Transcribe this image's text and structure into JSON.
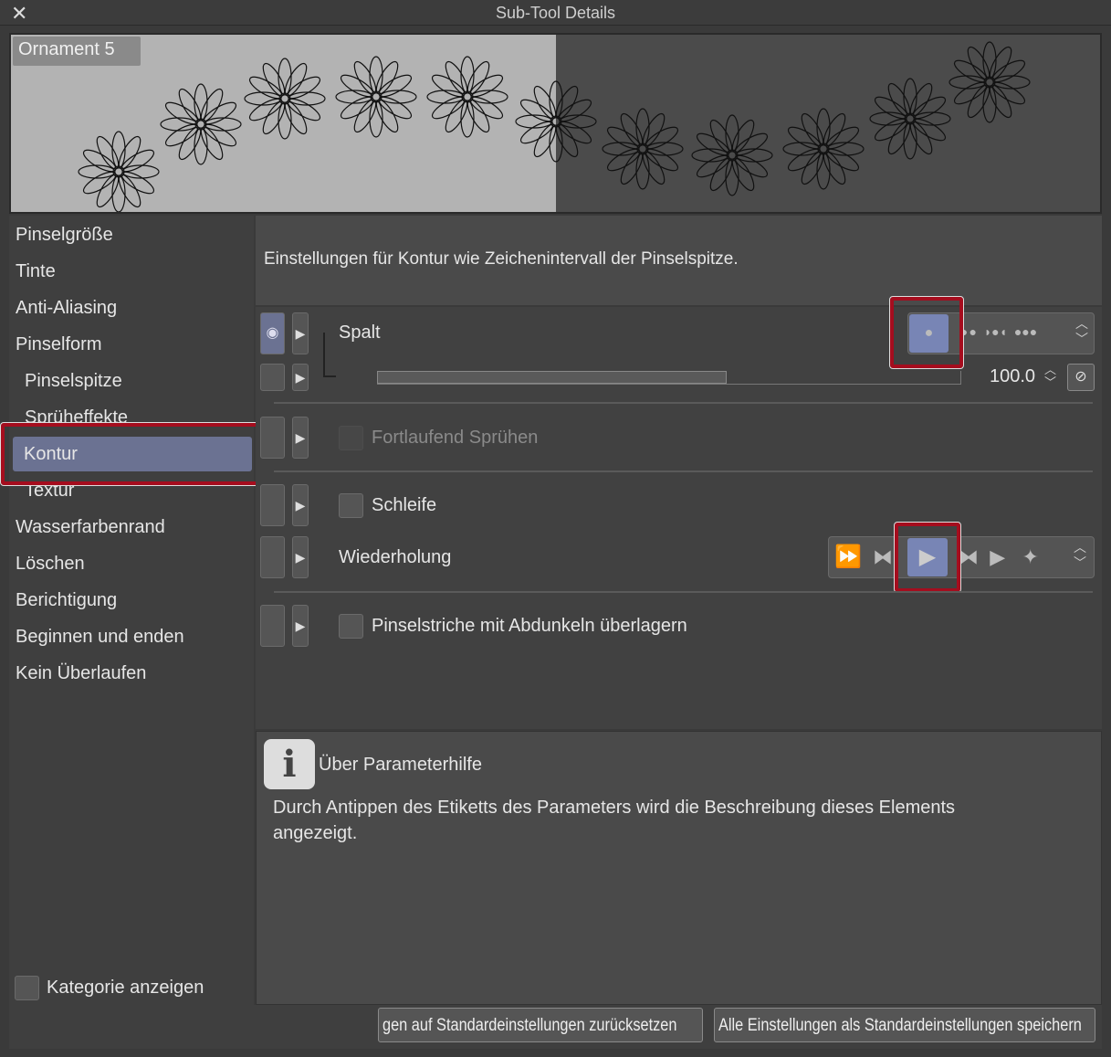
{
  "window": {
    "title": "Sub-Tool Details"
  },
  "preview": {
    "preset_name": "Ornament 5"
  },
  "sidebar": {
    "categories": [
      "Pinselgröße",
      "Tinte",
      "Anti-Aliasing",
      "Pinselform",
      "Pinselspitze",
      "Sprüheffekte",
      "Kontur",
      "Textur",
      "Wasserfarbenrand",
      "Löschen",
      "Berichtigung",
      "Beginnen und enden",
      "Kein Überlaufen"
    ],
    "selected": "Kontur",
    "show_category_label": "Kategorie anzeigen"
  },
  "description": "Einstellungen für Kontur wie Zeichenintervall der Pinselspitze.",
  "params": {
    "gap": {
      "label": "Spalt",
      "value": "100.0",
      "slider_fraction": 0.6,
      "selected_mode": "single dot"
    },
    "continuous_spray": {
      "label": "Fortlaufend Sprühen",
      "checked": false,
      "enabled": false
    },
    "loop": {
      "label": "Schleife",
      "checked": false
    },
    "repeat": {
      "label": "Wiederholung",
      "selected_mode": 3
    },
    "overlay": {
      "label": "Pinselstriche mit Abdunkeln überlagern",
      "checked": false
    }
  },
  "help": {
    "title": "Über Parameterhilfe",
    "text": "Durch Antippen des Etiketts des Parameters wird die Beschreibung dieses Elements angezeigt."
  },
  "buttons": {
    "reset": "gen auf Standardeinstellungen zurücksetzen",
    "save": "Alle Einstellungen als Standardeinstellungen speichern"
  },
  "colors": {
    "accent": "#7885b5",
    "highlight": "#a50d1e"
  }
}
